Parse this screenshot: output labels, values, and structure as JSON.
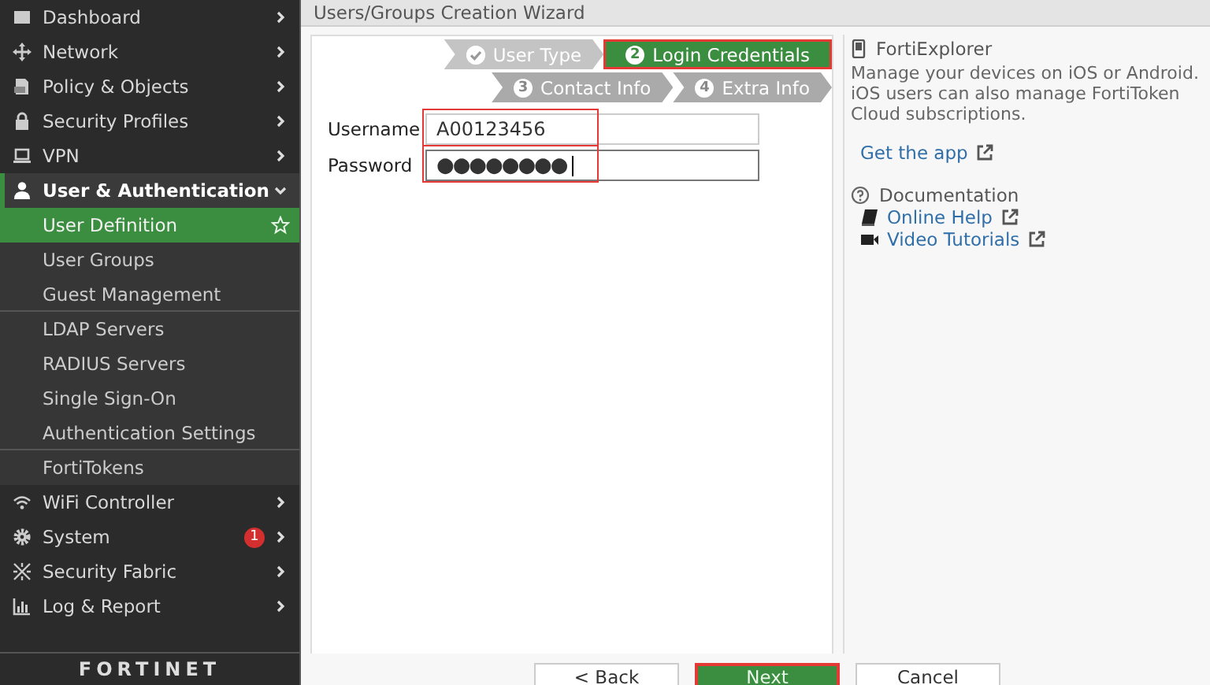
{
  "sidebar": {
    "items": [
      {
        "label": "Dashboard",
        "expanded": false
      },
      {
        "label": "Network",
        "expanded": false
      },
      {
        "label": "Policy & Objects",
        "expanded": false
      },
      {
        "label": "Security Profiles",
        "expanded": false
      },
      {
        "label": "VPN",
        "expanded": false
      },
      {
        "label": "User & Authentication",
        "expanded": true,
        "groups": [
          [
            {
              "label": "User Definition",
              "selected": true
            },
            {
              "label": "User Groups",
              "selected": false
            },
            {
              "label": "Guest Management",
              "selected": false
            }
          ],
          [
            {
              "label": "LDAP Servers",
              "selected": false
            },
            {
              "label": "RADIUS Servers",
              "selected": false
            },
            {
              "label": "Single Sign-On",
              "selected": false
            },
            {
              "label": "Authentication Settings",
              "selected": false
            }
          ],
          [
            {
              "label": "FortiTokens",
              "selected": false
            }
          ]
        ]
      },
      {
        "label": "WiFi Controller",
        "expanded": false
      },
      {
        "label": "System",
        "expanded": false,
        "badge": "1"
      },
      {
        "label": "Security Fabric",
        "expanded": false
      },
      {
        "label": "Log & Report",
        "expanded": false
      }
    ],
    "logo": "FORTINET"
  },
  "wizard": {
    "title": "Users/Groups Creation Wizard",
    "steps": [
      [
        {
          "label": "User Type",
          "completed": true,
          "selected": false,
          "highlighted": false
        },
        {
          "number": "2",
          "label": "Login Credentials",
          "completed": false,
          "selected": true,
          "highlighted": true
        }
      ],
      [
        {
          "number": "3",
          "label": "Contact Info",
          "completed": false,
          "selected": false,
          "highlighted": false
        },
        {
          "number": "4",
          "label": "Extra Info",
          "completed": false,
          "selected": false,
          "highlighted": false
        }
      ]
    ],
    "fields": [
      {
        "label": "Username",
        "kind": "text",
        "value": "A00123456",
        "highlighted": true,
        "focused": false
      },
      {
        "label": "Password",
        "kind": "password",
        "value": "●●●●●●●●",
        "highlighted": true,
        "focused": true
      }
    ],
    "buttons": [
      {
        "label": "< Back",
        "primary": false,
        "highlighted": false
      },
      {
        "label": "Next",
        "primary": true,
        "highlighted": true
      },
      {
        "label": "Cancel",
        "primary": false,
        "highlighted": false
      }
    ]
  },
  "info_panel": {
    "fortiexplorer": {
      "title": "FortiExplorer",
      "text": "Manage your devices on iOS or Android. iOS users can also manage FortiToken Cloud subscriptions.",
      "link": "Get the app"
    },
    "documentation": {
      "title": "Documentation",
      "links": [
        {
          "label": "Online Help",
          "kind": "book"
        },
        {
          "label": "Video Tutorials",
          "kind": "video"
        }
      ]
    }
  }
}
